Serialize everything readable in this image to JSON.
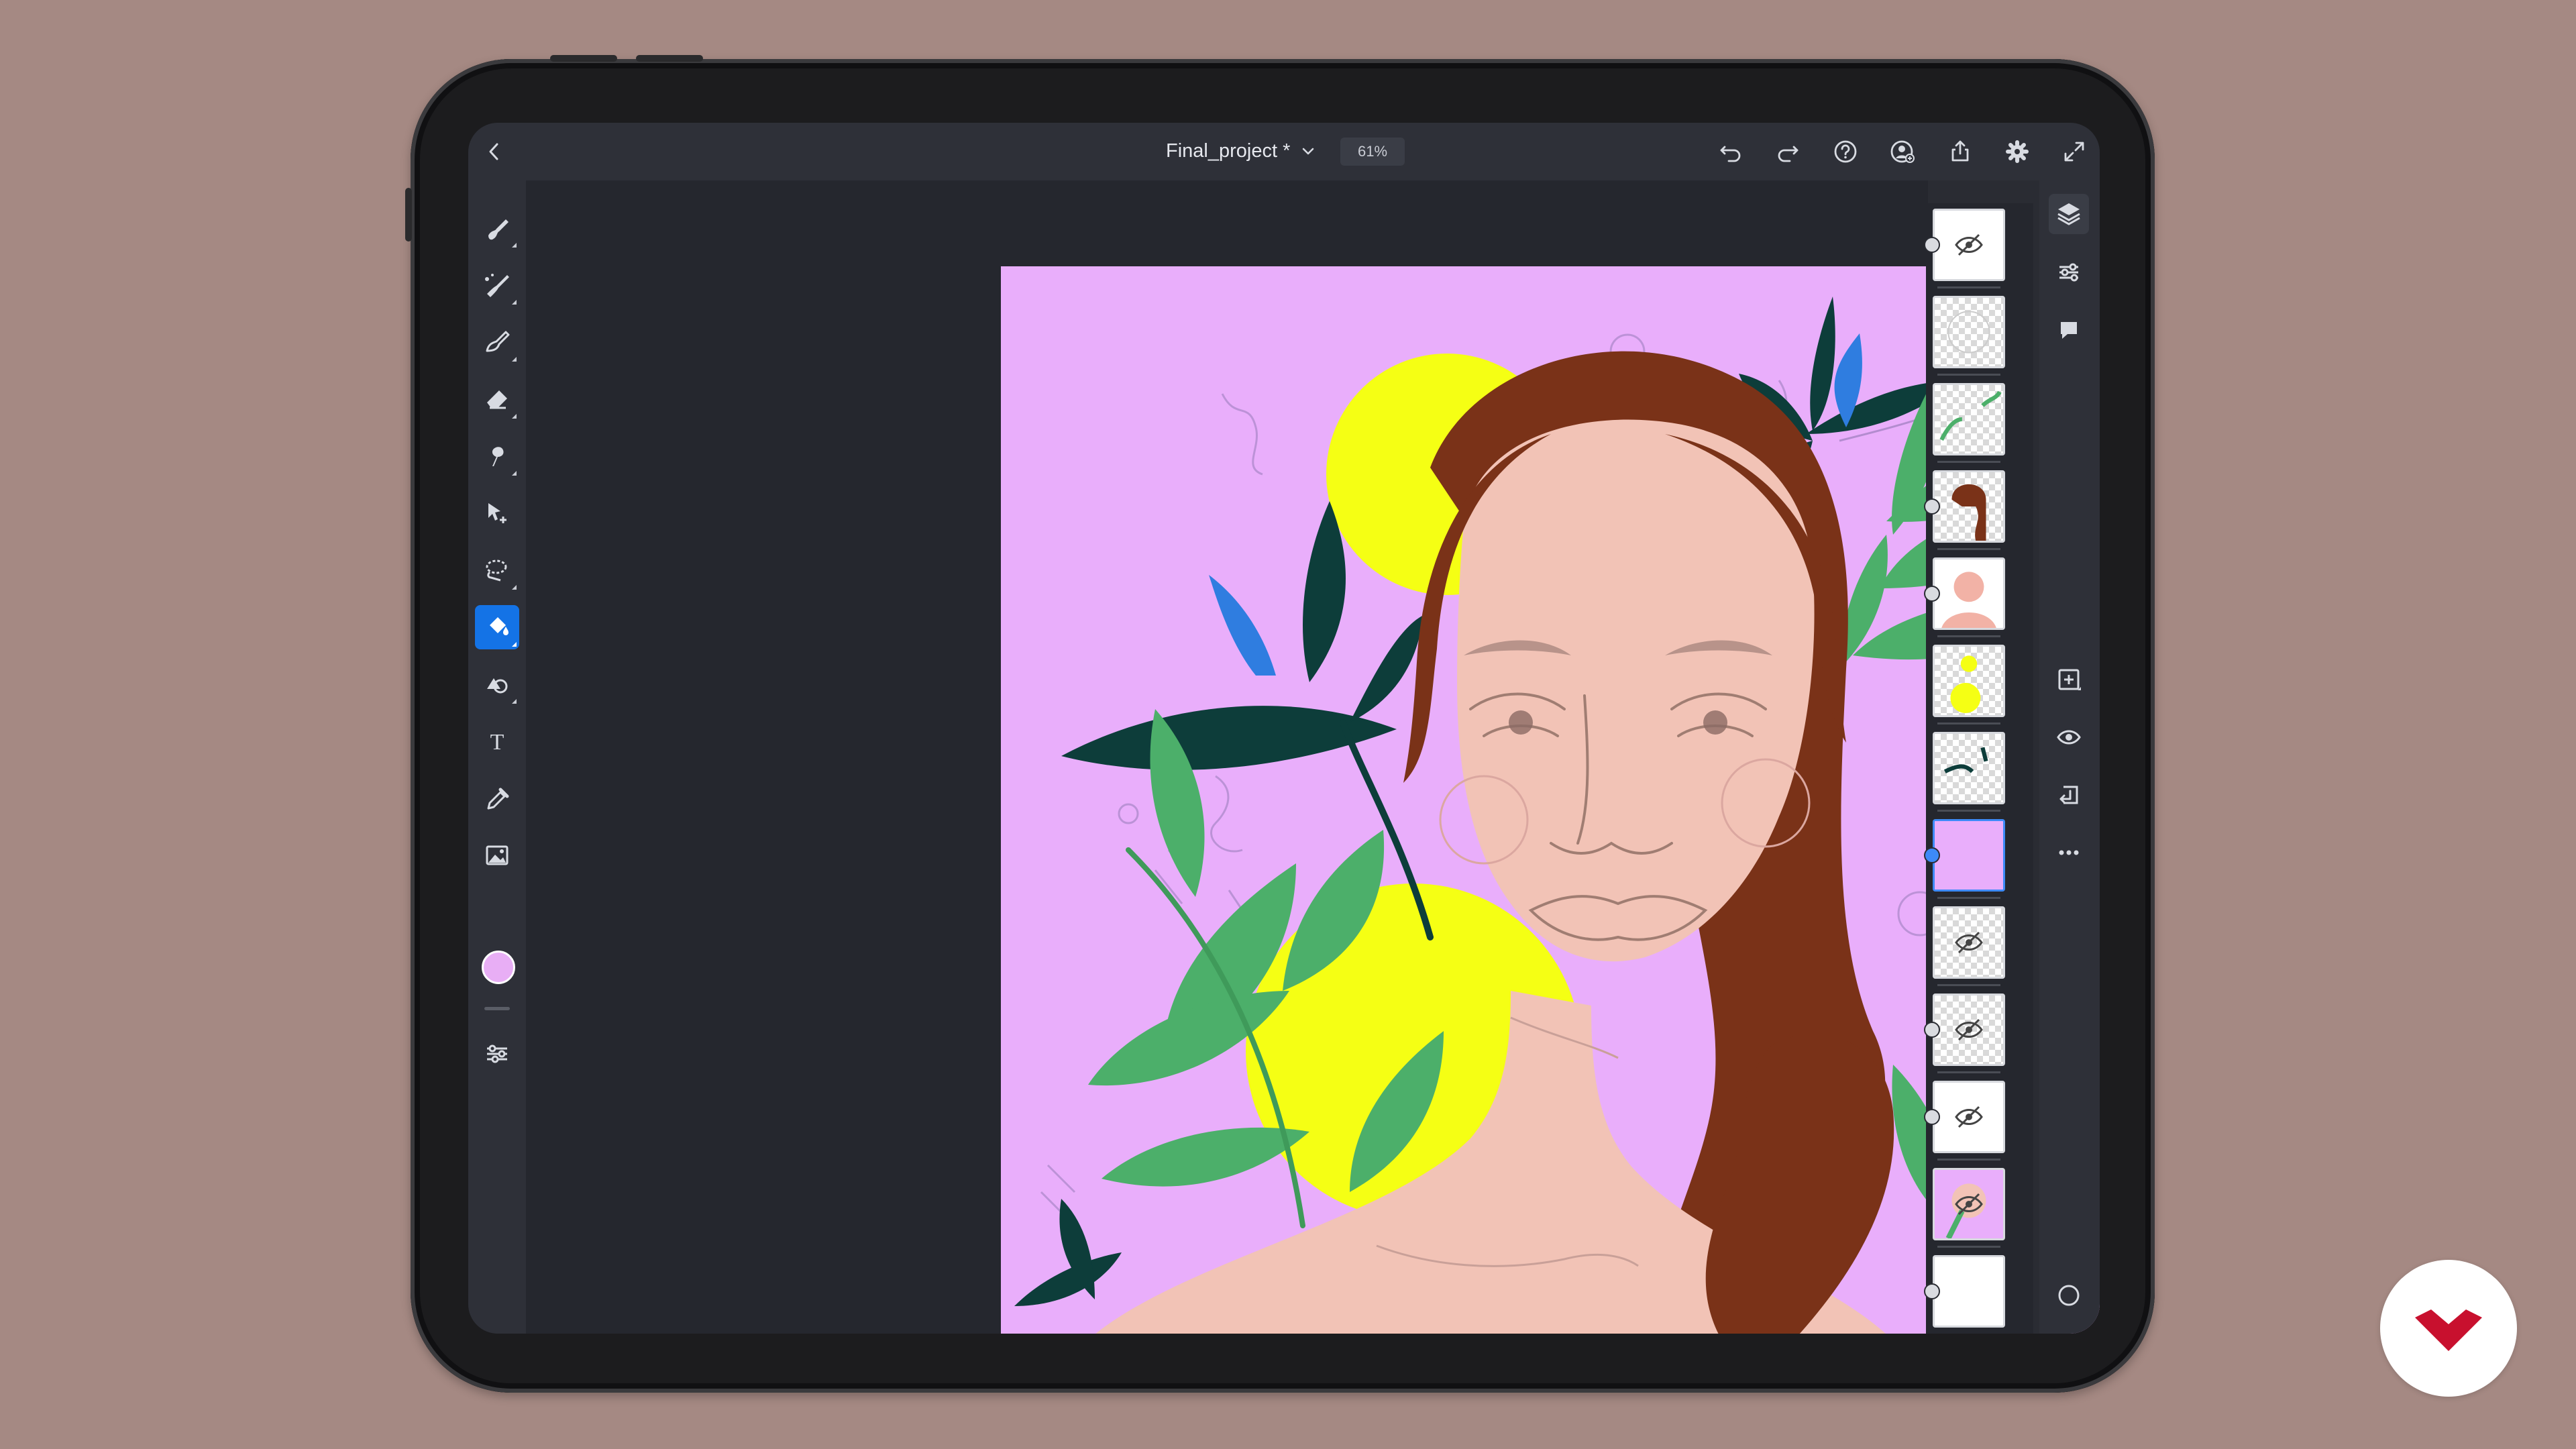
{
  "document": {
    "title": "Final_project *",
    "zoom": "61%"
  },
  "colors": {
    "background": "#a58983",
    "accent": "#1473e6",
    "canvas_pink": "#e9aefb",
    "sun_yellow": "#f5ff14",
    "skin": "#f2c3b6",
    "hair": "#7a3218",
    "leaf_green": "#4caf6a",
    "leaf_dark": "#0d3d3a",
    "flower_blue": "#2f7de0",
    "current_color": "#e8aef5",
    "logo_red": "#c8102e"
  },
  "topbar": {
    "back_icon": "chevron-left-icon",
    "dropdown_icon": "chevron-down-icon",
    "actions": [
      "undo-icon",
      "redo-icon",
      "help-icon",
      "user-icon",
      "share-icon",
      "settings-icon",
      "fullscreen-icon"
    ]
  },
  "toolbar": {
    "tools": [
      "pixel-brush-icon",
      "live-brush-icon",
      "vector-brush-icon",
      "eraser-icon",
      "smudge-icon",
      "move-icon",
      "lasso-icon",
      "fill-icon",
      "shape-icon",
      "type-icon",
      "eyedropper-icon",
      "place-image-icon"
    ],
    "active_tool": "fill-icon",
    "type_tool_glyph": "T",
    "bottom_tool": "touch-modifier-icon"
  },
  "layers": {
    "selected_index": 7,
    "items": [
      {
        "name": "layer-1",
        "hidden": true
      },
      {
        "name": "layer-2",
        "hidden": false
      },
      {
        "name": "layer-3",
        "hidden": false
      },
      {
        "name": "layer-4",
        "hidden": false
      },
      {
        "name": "layer-5",
        "hidden": false
      },
      {
        "name": "layer-6",
        "hidden": false
      },
      {
        "name": "layer-7",
        "hidden": false
      },
      {
        "name": "layer-8",
        "hidden": false
      },
      {
        "name": "layer-9",
        "hidden": true
      },
      {
        "name": "layer-10",
        "hidden": true
      },
      {
        "name": "layer-11",
        "hidden": true
      },
      {
        "name": "layer-12",
        "hidden": true
      },
      {
        "name": "layer-13",
        "hidden": false
      }
    ]
  },
  "rightbar": {
    "top_icons": [
      "layers-icon",
      "properties-icon",
      "comments-icon"
    ],
    "mid_icons": [
      "add-layer-icon",
      "visibility-icon",
      "merge-layer-icon",
      "more-options-icon"
    ],
    "bottom_icon": "circle-icon"
  },
  "logo": {
    "icon": "domestika-logo-icon"
  }
}
